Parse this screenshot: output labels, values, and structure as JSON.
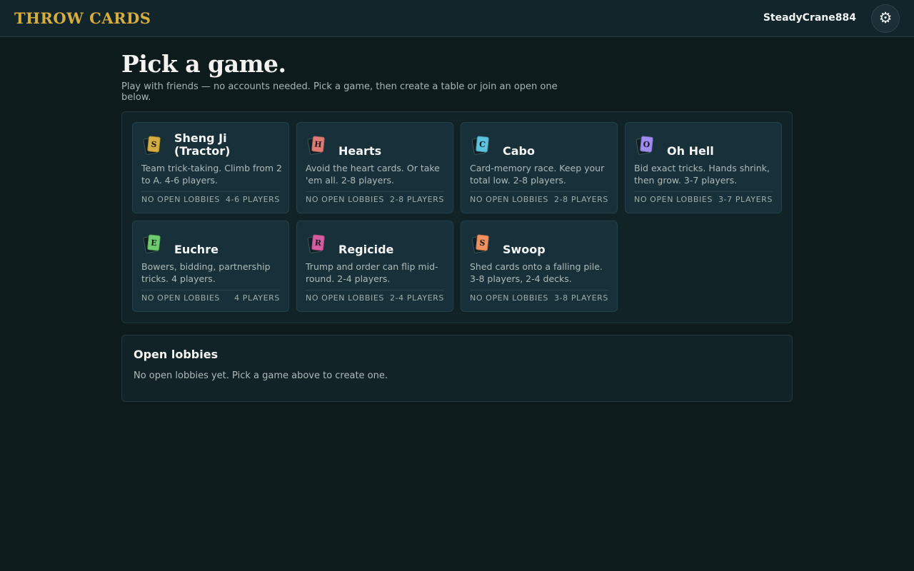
{
  "header": {
    "brand": "THROW CARDS",
    "username": "SteadyCrane884",
    "settings_icon": "gear-icon"
  },
  "main": {
    "title": "Pick a game.",
    "subtitle": "Play with friends — no accounts needed. Pick a game, then create a table or join an open one below."
  },
  "games": [
    {
      "letter": "S",
      "color": "#d6ad3f",
      "name": "Sheng Ji (Tractor)",
      "description": "Team trick-taking. Climb from 2 to A. 4-6 players.",
      "status": "NO OPEN LOBBIES",
      "players": "4-6 PLAYERS"
    },
    {
      "letter": "H",
      "color": "#e07a75",
      "name": "Hearts",
      "description": "Avoid the heart cards. Or take 'em all. 2-8 players.",
      "status": "NO OPEN LOBBIES",
      "players": "2-8 PLAYERS"
    },
    {
      "letter": "C",
      "color": "#5cc3df",
      "name": "Cabo",
      "description": "Card-memory race. Keep your total low. 2-8 players.",
      "status": "NO OPEN LOBBIES",
      "players": "2-8 PLAYERS"
    },
    {
      "letter": "O",
      "color": "#9e8cf0",
      "name": "Oh Hell",
      "description": "Bid exact tricks. Hands shrink, then grow. 3-7 players.",
      "status": "NO OPEN LOBBIES",
      "players": "3-7 PLAYERS"
    },
    {
      "letter": "E",
      "color": "#6dcc6d",
      "name": "Euchre",
      "description": "Bowers, bidding, partnership tricks. 4 players.",
      "status": "NO OPEN LOBBIES",
      "players": "4 PLAYERS"
    },
    {
      "letter": "R",
      "color": "#d45ca1",
      "name": "Regicide",
      "description": "Trump and order can flip mid-round. 2-4 players.",
      "status": "NO OPEN LOBBIES",
      "players": "2-4 PLAYERS"
    },
    {
      "letter": "S",
      "color": "#f0925f",
      "name": "Swoop",
      "description": "Shed cards onto a falling pile. 3-8 players, 2-4 decks.",
      "status": "NO OPEN LOBBIES",
      "players": "3-8 PLAYERS"
    }
  ],
  "lobbies": {
    "title": "Open lobbies",
    "empty_message": "No open lobbies yet. Pick a game above to create one."
  }
}
